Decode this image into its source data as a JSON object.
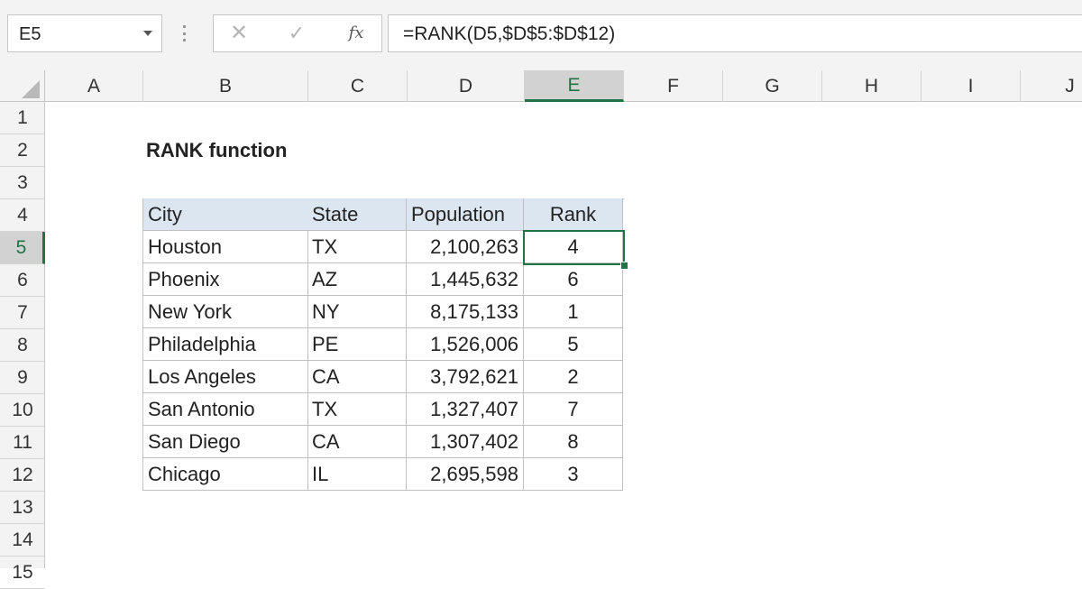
{
  "name_box": {
    "value": "E5"
  },
  "formula_bar": {
    "formula": "=RANK(D5,$D$5:$D$12)",
    "cancel_icon": "x-icon",
    "enter_icon": "check-icon",
    "fx_label": "fx"
  },
  "columns": [
    "A",
    "B",
    "C",
    "D",
    "E",
    "F",
    "G",
    "H",
    "I",
    "J"
  ],
  "rows": [
    "1",
    "2",
    "3",
    "4",
    "5",
    "6",
    "7",
    "8",
    "9",
    "10",
    "11",
    "12",
    "13",
    "14",
    "15"
  ],
  "active": {
    "column": "E",
    "row": "5"
  },
  "sheet": {
    "title": "RANK function",
    "table": {
      "headers": [
        "City",
        "State",
        "Population",
        "Rank"
      ],
      "rows": [
        [
          "Houston",
          "TX",
          "2,100,263",
          "4"
        ],
        [
          "Phoenix",
          "AZ",
          "1,445,632",
          "6"
        ],
        [
          "New York",
          "NY",
          "8,175,133",
          "1"
        ],
        [
          "Philadelphia",
          "PE",
          "1,526,006",
          "5"
        ],
        [
          "Los Angeles",
          "CA",
          "3,792,621",
          "2"
        ],
        [
          "San Antonio",
          "TX",
          "1,327,407",
          "7"
        ],
        [
          "San Diego",
          "CA",
          "1,307,402",
          "8"
        ],
        [
          "Chicago",
          "IL",
          "2,695,598",
          "3"
        ]
      ]
    }
  },
  "colors": {
    "accent": "#217346",
    "header_fill": "#dce6f1"
  }
}
